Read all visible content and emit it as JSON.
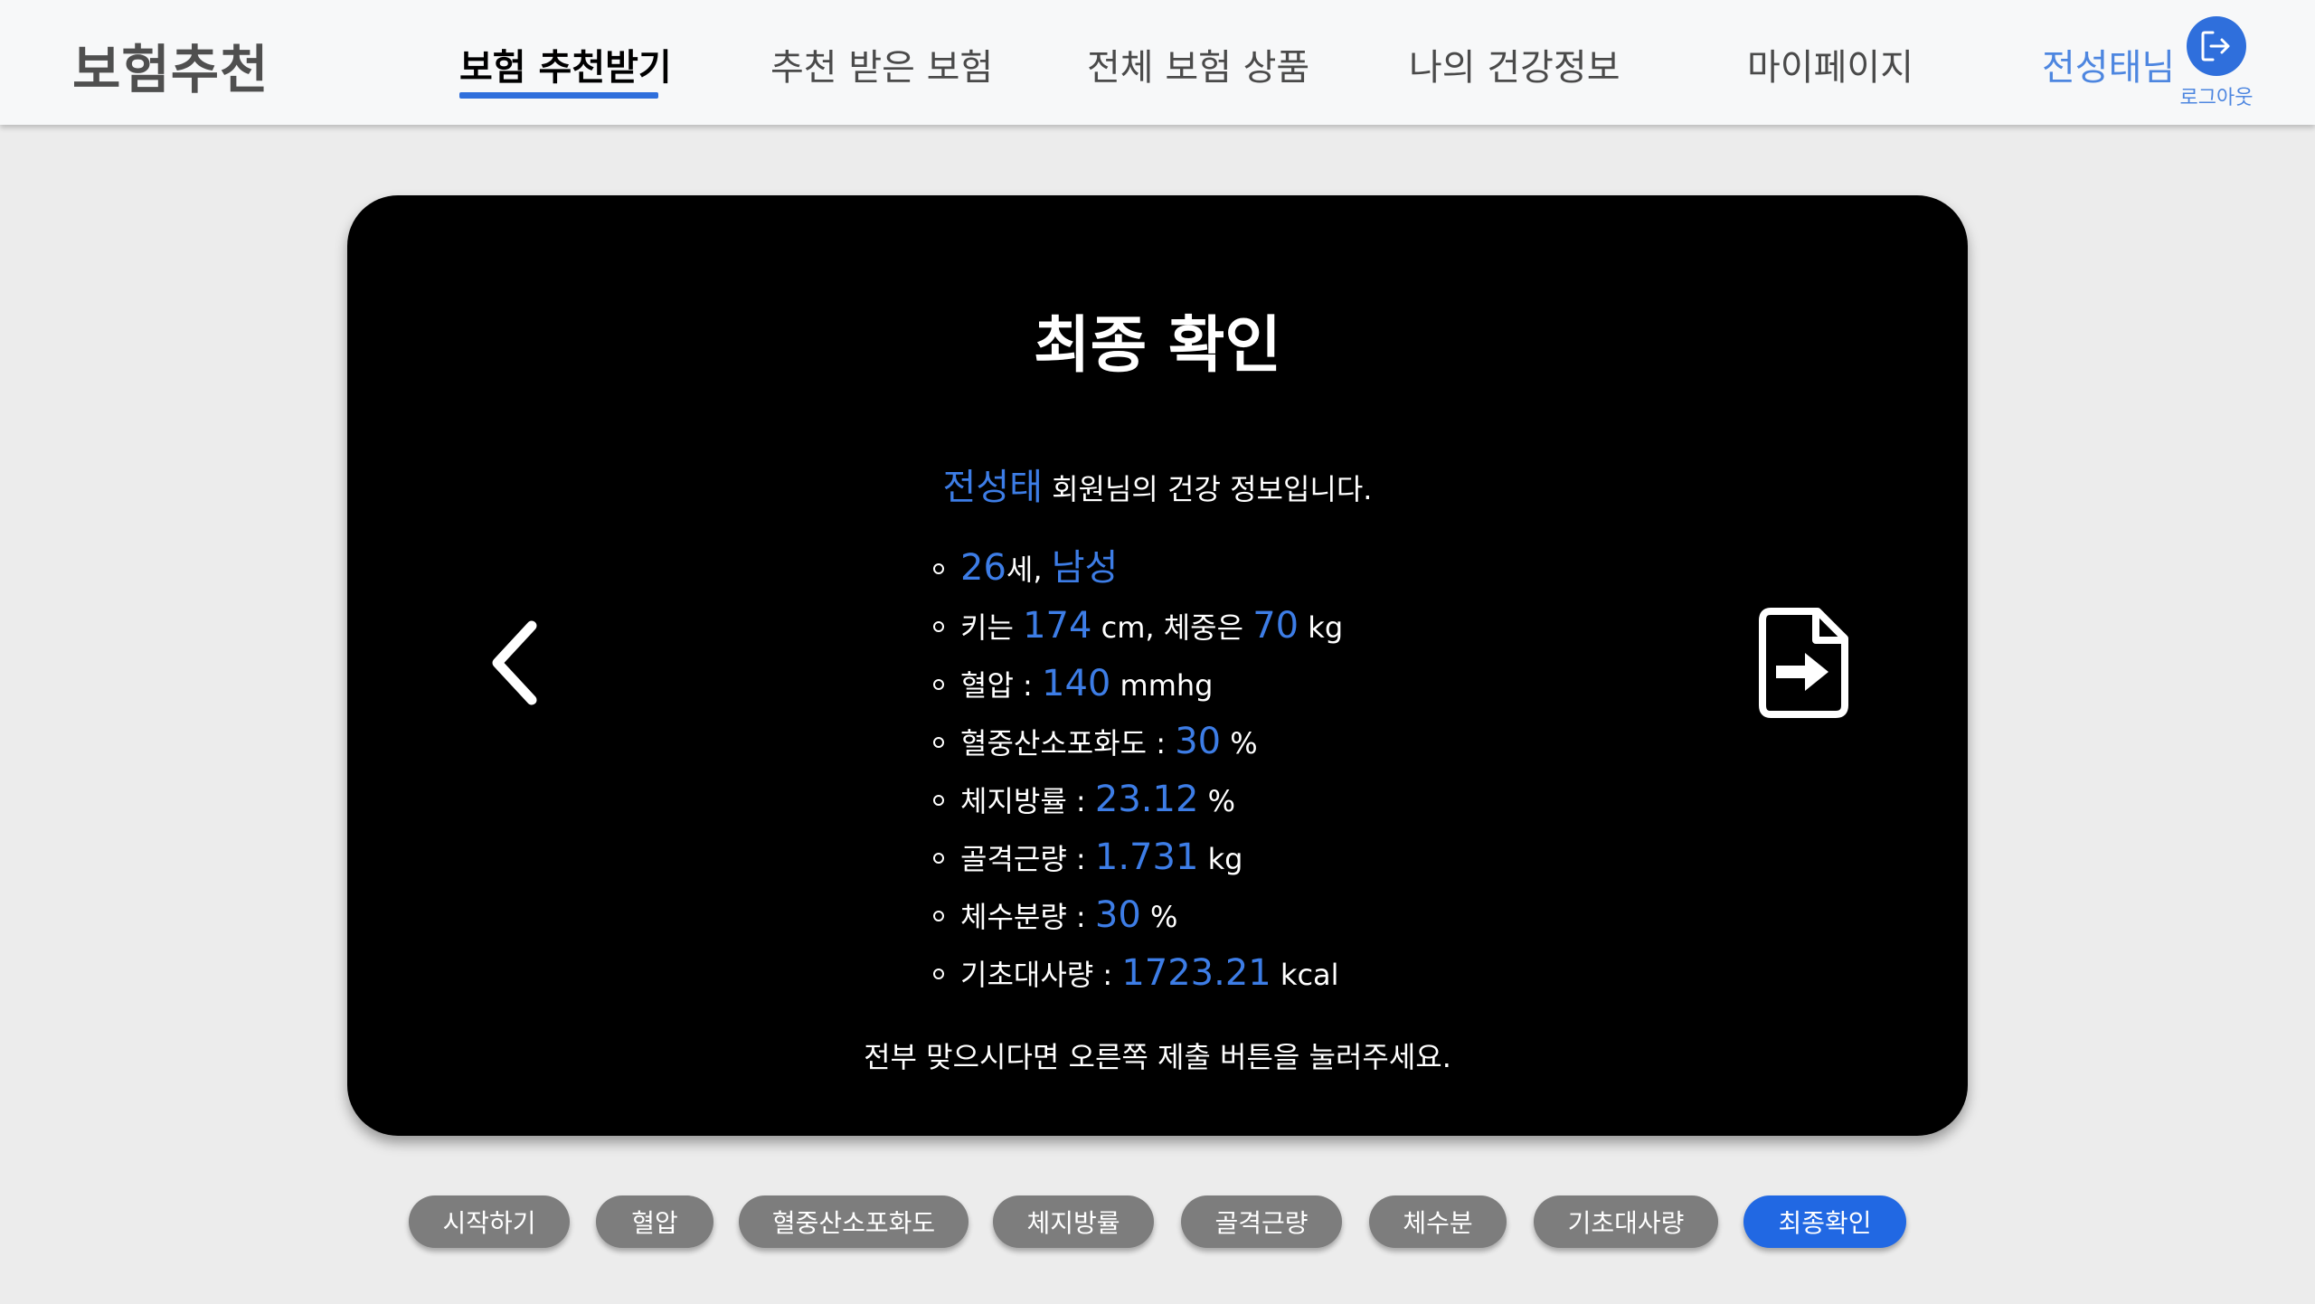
{
  "header": {
    "logo": "보험추천",
    "nav": [
      "보험 추천받기",
      "추천 받은 보험",
      "전체 보험 상품",
      "나의 건강정보",
      "마이페이지"
    ],
    "user_name": "전성태님",
    "logout_label": "로그아웃"
  },
  "card": {
    "title": "최종 확인",
    "member_name": "전성태",
    "intro_suffix": " 회원님의 건강 정보입니다.",
    "age": "26",
    "age_unit": "세, ",
    "gender": "남성",
    "height_prefix": "키는 ",
    "height": "174",
    "height_unit": " cm, 체중은 ",
    "weight": "70",
    "weight_unit": " kg",
    "bp_label": "혈압 : ",
    "bp": "140",
    "bp_unit": " mmhg",
    "spo2_label": "혈중산소포화도 : ",
    "spo2": "30",
    "spo2_unit": " %",
    "fat_label": "체지방률 : ",
    "fat": "23.12",
    "fat_unit": " %",
    "muscle_label": "골격근량 : ",
    "muscle": "1.731",
    "muscle_unit": " kg",
    "water_label": "체수분량 : ",
    "water": "30",
    "water_unit": " %",
    "bmr_label": "기초대사량 : ",
    "bmr": "1723.21",
    "bmr_unit": " kcal",
    "confirm_text": "전부 맞으시다면 오른쪽 제출 버튼을 눌러주세요."
  },
  "steps": [
    "시작하기",
    "혈압",
    "혈중산소포화도",
    "체지방률",
    "골격근량",
    "체수분",
    "기초대사량",
    "최종확인"
  ],
  "active_step": "최종확인",
  "colors": {
    "accent": "#2f6fdc",
    "value_blue": "#3d7de6",
    "pill_gray": "#7d7d7d",
    "card_bg": "#000000",
    "page_bg": "#ececec"
  },
  "icons": {
    "logout": "logout-icon",
    "back": "chevron-left-icon",
    "submit": "file-arrow-right-icon"
  }
}
